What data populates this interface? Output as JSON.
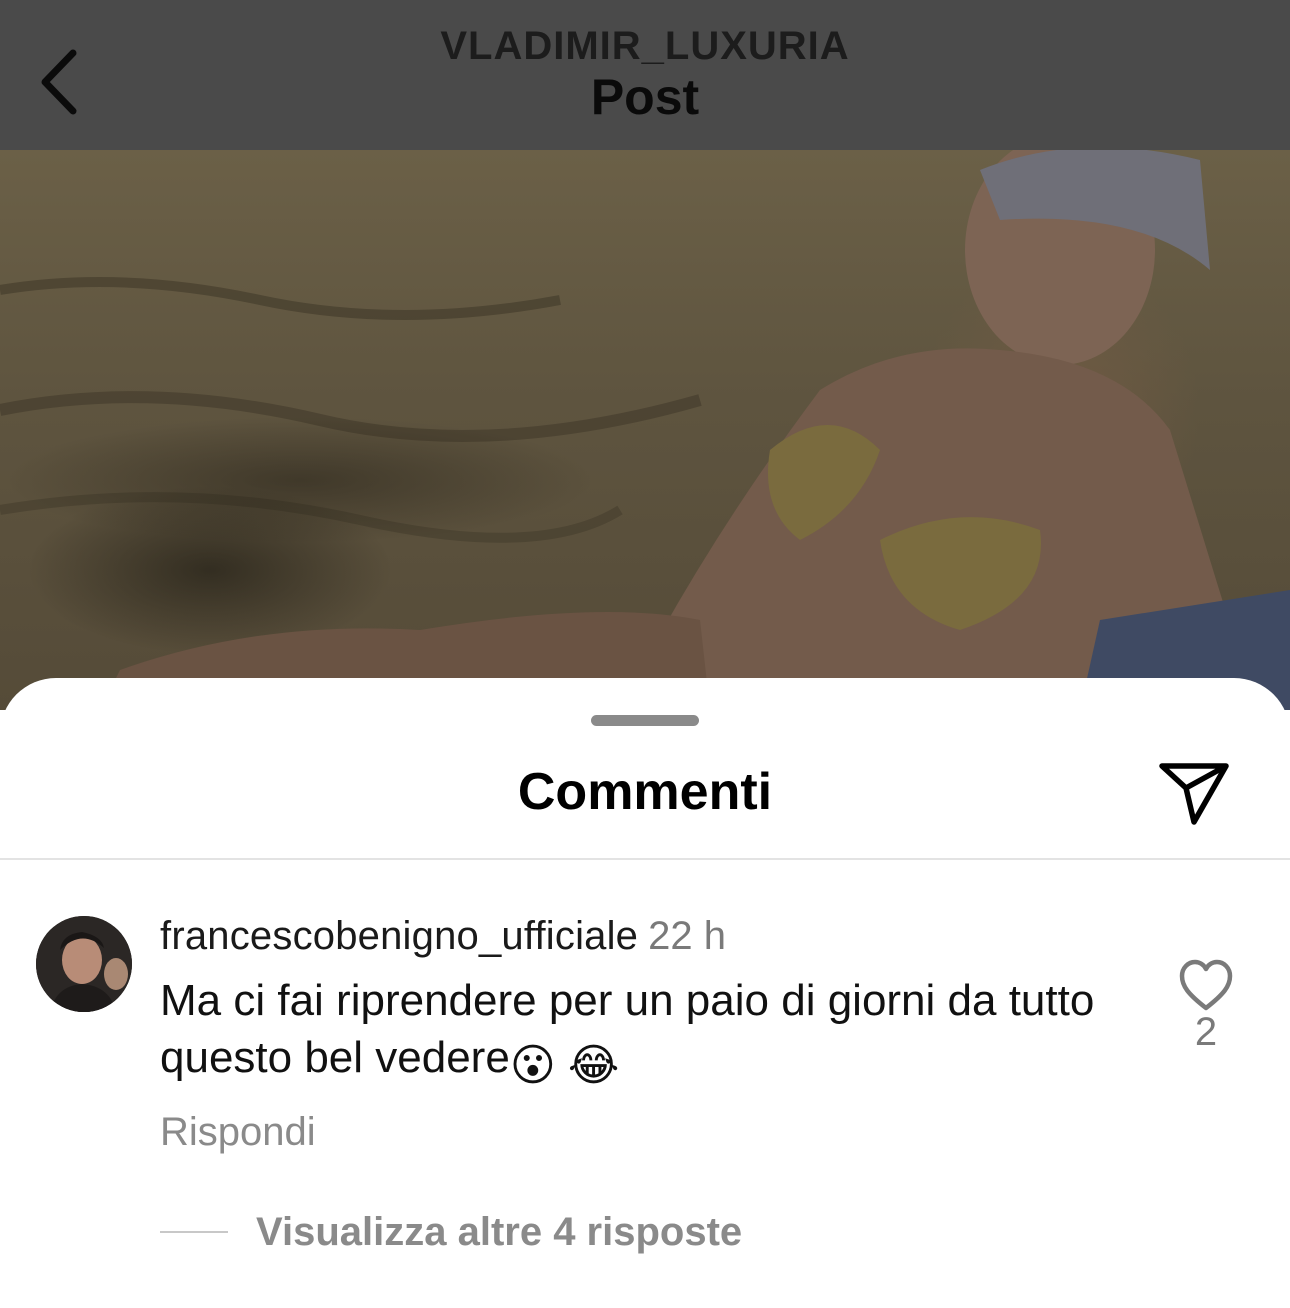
{
  "header": {
    "username": "VLADIMIR_LUXURIA",
    "title": "Post",
    "back_icon": "chevron-left-icon"
  },
  "sheet": {
    "title": "Commenti",
    "share_icon": "paper-plane-icon"
  },
  "comments": [
    {
      "username": "francescobenigno_ufficiale",
      "time": "22 h",
      "text": "Ma ci fai riprendere per un paio di giorni da tutto questo bel vedere",
      "emojis": [
        "😮",
        "😂"
      ],
      "reply_label": "Rispondi",
      "like_icon": "heart-outline-icon",
      "like_count": "2",
      "more_replies_label": "Visualizza altre 4 risposte"
    }
  ],
  "colors": {
    "header_dim": "#4a4a4a",
    "secondary_text": "#8a8a8a",
    "primary_text": "#111111"
  }
}
